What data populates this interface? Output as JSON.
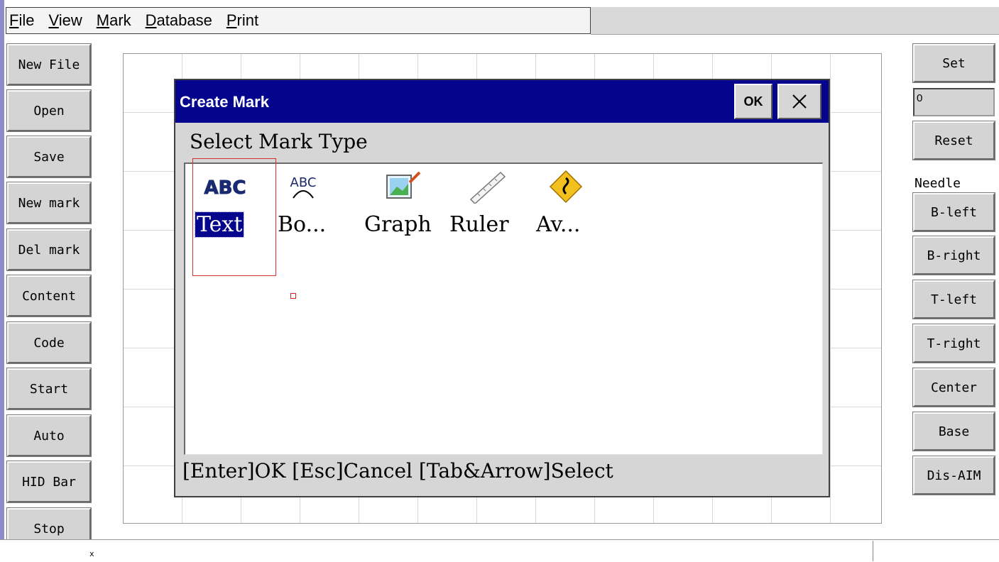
{
  "menu": {
    "items": [
      {
        "u": "F",
        "rest": "ile"
      },
      {
        "u": "V",
        "rest": "iew"
      },
      {
        "u": "M",
        "rest": "ark"
      },
      {
        "u": "D",
        "rest": "atabase"
      },
      {
        "u": "P",
        "rest": "rint"
      }
    ]
  },
  "left_buttons": [
    "New File",
    "Open",
    "Save",
    "New mark",
    "Del mark",
    "Content",
    "Code",
    "Start",
    "Auto",
    "HID Bar",
    "Stop"
  ],
  "right_panel": {
    "set": "Set",
    "value": "0",
    "reset": "Reset",
    "needle_label": "Needle",
    "buttons": [
      "B-left",
      "B-right",
      "T-left",
      "T-right",
      "Center",
      "Base",
      "Dis-AIM"
    ]
  },
  "dialog": {
    "title": "Create Mark",
    "ok": "OK",
    "close_icon": "close-icon",
    "heading": "Select Mark Type",
    "items": [
      {
        "label": "Text",
        "icon": "abc-text-icon",
        "selected": true
      },
      {
        "label": "Bo...",
        "icon": "arc-text-icon",
        "selected": false
      },
      {
        "label": "Graph",
        "icon": "picture-icon",
        "selected": false
      },
      {
        "label": "Ruler",
        "icon": "ruler-icon",
        "selected": false
      },
      {
        "label": "Av...",
        "icon": "winding-road-sign-icon",
        "selected": false
      }
    ],
    "footer": "[Enter]OK [Esc]Cancel [Tab&Arrow]Select"
  },
  "status_mark": "x"
}
